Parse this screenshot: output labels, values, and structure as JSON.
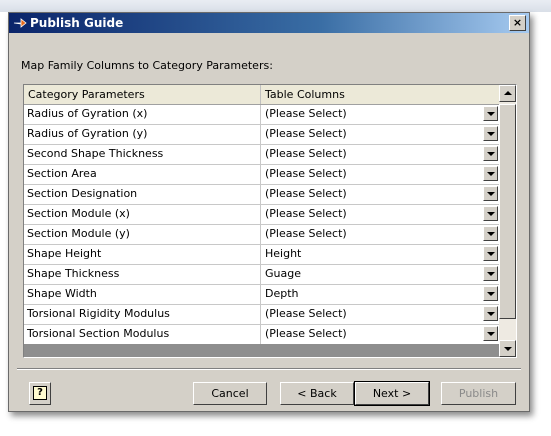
{
  "dialog": {
    "title": "Publish Guide",
    "close_label": "×",
    "instruction": "Map Family Columns to Category Parameters:"
  },
  "grid": {
    "headers": [
      "Category Parameters",
      "Table Columns"
    ],
    "rows": [
      {
        "param": "Radius of Gyration (x)",
        "column": "(Please Select)"
      },
      {
        "param": "Radius of Gyration (y)",
        "column": "(Please Select)"
      },
      {
        "param": "Second Shape Thickness",
        "column": "(Please Select)"
      },
      {
        "param": "Section Area",
        "column": "(Please Select)"
      },
      {
        "param": "Section Designation",
        "column": "(Please Select)"
      },
      {
        "param": "Section Module (x)",
        "column": "(Please Select)"
      },
      {
        "param": "Section Module (y)",
        "column": "(Please Select)"
      },
      {
        "param": "Shape Height",
        "column": "Height"
      },
      {
        "param": "Shape Thickness",
        "column": "Guage"
      },
      {
        "param": "Shape Width",
        "column": "Depth"
      },
      {
        "param": "Torsional Rigidity Modulus",
        "column": "(Please Select)"
      },
      {
        "param": "Torsional Section Modulus",
        "column": "(Please Select)"
      }
    ]
  },
  "buttons": {
    "help": "?",
    "cancel": "Cancel",
    "back": "< Back",
    "next": "Next >",
    "publish": "Publish"
  },
  "icons": {
    "title": "publish-arrow-icon",
    "dropdown": "chevron-down-icon",
    "help": "help-icon"
  }
}
